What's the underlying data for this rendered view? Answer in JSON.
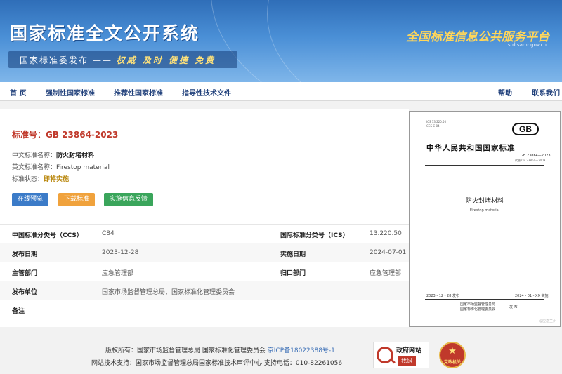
{
  "header": {
    "site_title": "国家标准全文公开系统",
    "slogan_prefix": "国家标准委发布 ——",
    "slogan_keywords": "权威 及时 便捷 免费",
    "platform_name": "全国标准信息公共服务平台",
    "platform_url": "std.samr.gov.cn"
  },
  "nav": {
    "home": "首 页",
    "mandatory": "强制性国家标准",
    "recommended": "推荐性国家标准",
    "guidance": "指导性技术文件",
    "help": "帮助",
    "contact": "联系我们"
  },
  "standard": {
    "number": "标准号：GB 23864-2023",
    "cn_name_label": "中文标准名称：",
    "cn_name": "防火封堵材料",
    "en_name_label": "英文标准名称：",
    "en_name": "Firestop material",
    "status_label": "标准状态：",
    "status": "即将实施"
  },
  "buttons": {
    "preview": "在线预览",
    "download": "下载标准",
    "feedback": "实施信息反馈"
  },
  "details": {
    "ccs_label": "中国标准分类号（CCS）",
    "ccs": "C84",
    "ics_label": "国际标准分类号（ICS）",
    "ics": "13.220.50",
    "publish_label": "发布日期",
    "publish": "2023-12-28",
    "implement_label": "实施日期",
    "implement": "2024-07-01",
    "dept_label": "主管部门",
    "dept": "应急管理部",
    "attr_label": "归口部门",
    "attr": "应急管理部",
    "issuer_label": "发布单位",
    "issuer": "国家市场监督管理总局、国家标准化管理委员会",
    "remark_label": "备注"
  },
  "cover": {
    "ics_small": "ICS 13.220.50",
    "ccs_small": "CCS C 84",
    "gb_logo": "GB",
    "country_title": "中华人民共和国国家标准",
    "std_code": "GB 23864—2023",
    "replaces": "代替 GB 23864—2009",
    "name_cn": "防火封堵材料",
    "name_en": "Firestop material",
    "publish_date": "2023 - 12 - 28 发布",
    "implement_date": "2024 - 01 - XX 实施",
    "issuer_1": "国家市场监督管理总局",
    "issuer_2": "国家标准化管理委员会",
    "issue_word": "发 布",
    "watermark": "@应急兰州"
  },
  "footer": {
    "copyright": "版权所有：国家市场监督管理总局 国家标准化管理委员会",
    "icp": "京ICP备18022388号-1",
    "support": "网站技术支持：国家市场监督管理总局国家标准技术审评中心 支持电话：010-82261056",
    "gov_badge_title": "政府网站",
    "gov_badge_action": "找错",
    "party_badge": "党政机关"
  }
}
